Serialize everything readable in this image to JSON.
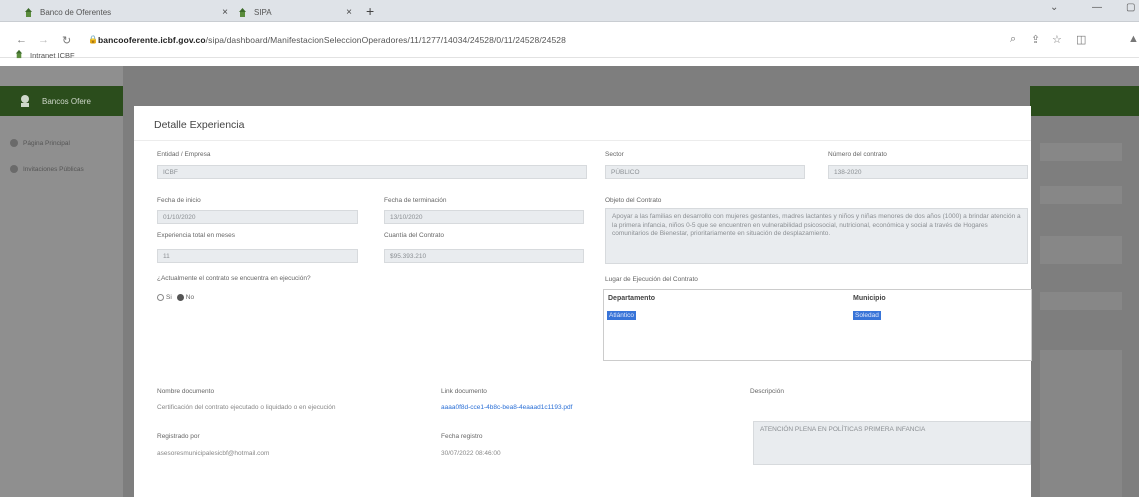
{
  "browser": {
    "tabs": [
      {
        "title": "Banco de Oferentes",
        "close": "×"
      },
      {
        "title": "SIPA",
        "close": "×"
      }
    ],
    "new_tab": "+",
    "url_host": "bancooferente.icbf.gov.co",
    "url_path": "/sipa/dashboard/ManifestacionSeleccionOperadores/11/1277/14034/24528/0/11/24528/24528",
    "bookmark": "Intranet ICBF"
  },
  "app": {
    "brand": "Bancos Ofere",
    "sidebar": [
      {
        "label": "Página Principal"
      },
      {
        "label": "Invitaciones Públicas"
      }
    ]
  },
  "modal": {
    "title": "Detalle Experiencia",
    "fields": {
      "entidad_label": "Entidad / Empresa",
      "entidad_value": "ICBF",
      "sector_label": "Sector",
      "sector_value": "PÚBLICO",
      "numero_contrato_label": "Número del contrato",
      "numero_contrato_value": "138-2020",
      "fecha_inicio_label": "Fecha de inicio",
      "fecha_inicio_value": "01/10/2020",
      "fecha_terminacion_label": "Fecha de terminación",
      "fecha_terminacion_value": "13/10/2020",
      "objeto_label": "Objeto del Contrato",
      "objeto_value": "Apoyar a las familias en desarrollo con mujeres gestantes, madres lactantes y niños y niñas menores de dos años (1000) a brindar atención a la primera infancia, niños 0-5 que se encuentren en vulnerabilidad psicosocial, nutricional, económica y social a través de Hogares comunitarios de Bienestar, prioritariamente en situación de desplazamiento.",
      "experiencia_label": "Experiencia total en meses",
      "experiencia_value": "11",
      "cuantia_label": "Cuantía del Contrato",
      "cuantia_value": "$95.393.210",
      "en_ejecucion_question": "¿Actualmente el contrato se encuentra en ejecución?",
      "radio_si": "Si",
      "radio_no": "No",
      "lugar_label": "Lugar de Ejecución del Contrato",
      "departamento_header": "Departamento",
      "municipio_header": "Municipio",
      "departamento_value": "Atlántico",
      "municipio_value": "Soledad",
      "nombre_documento_label": "Nombre documento",
      "nombre_documento_value": "Certificación del contrato ejecutado o liquidado o en ejecución",
      "link_documento_label": "Link documento",
      "link_documento_value": "aaaa0f8d-cce1-4b8c-bea8-4eaaad1c1193.pdf",
      "descripcion_label": "Descripción",
      "descripcion_value": "ATENCIÓN PLENA EN POLÍTICAS PRIMERA INFANCIA",
      "registrado_label": "Registrado por",
      "registrado_value": "asesoresmunicipalesicbf@hotmail.com",
      "fecha_registro_label": "Fecha registro",
      "fecha_registro_value": "30/07/2022 08:46:00"
    }
  }
}
